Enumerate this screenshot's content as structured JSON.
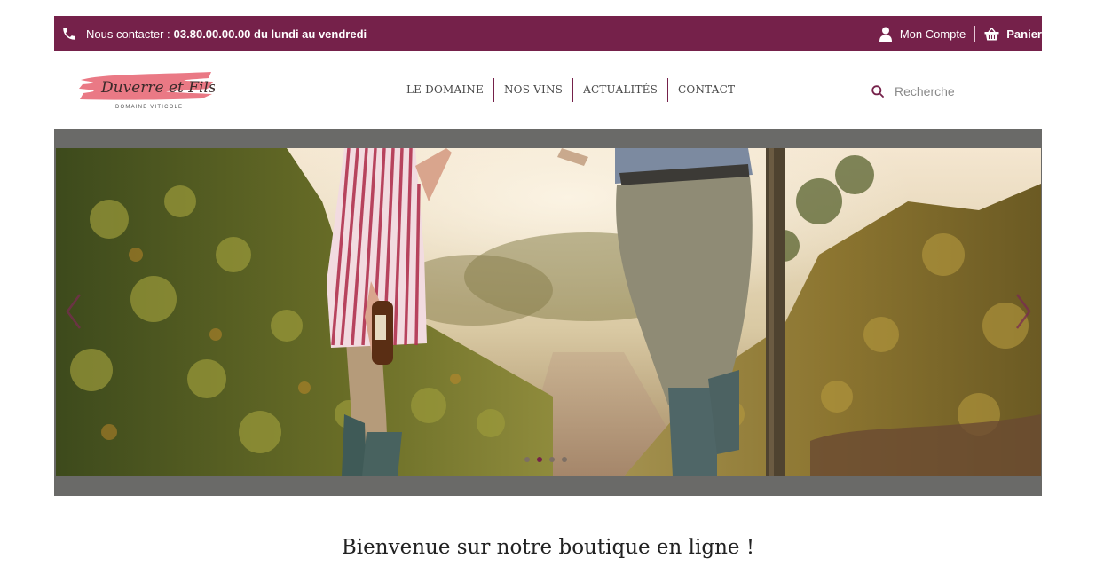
{
  "topbar": {
    "contact_label": "Nous contacter :",
    "contact_value": "03.80.00.00.00 du lundi au vendredi",
    "account_label": "Mon Compte",
    "cart_label": "Panier",
    "icons": {
      "phone": "phone-icon",
      "account": "user-icon",
      "cart": "basket-icon"
    },
    "background_color": "#75214a"
  },
  "logo": {
    "name": "Duverre et Fils",
    "tagline": "DOMAINE VITICOLE",
    "brush_color": "#e86a78"
  },
  "nav": {
    "items": [
      {
        "label": "LE DOMAINE"
      },
      {
        "label": "NOS VINS"
      },
      {
        "label": "ACTUALITÉS"
      },
      {
        "label": "CONTACT"
      }
    ]
  },
  "search": {
    "placeholder": "Recherche",
    "value": ""
  },
  "slider": {
    "slide_count": 4,
    "active_index": 1,
    "prev_icon": "chevron-left-icon",
    "next_icon": "chevron-right-icon"
  },
  "welcome_title": "Bienvenue sur notre boutique en ligne !"
}
